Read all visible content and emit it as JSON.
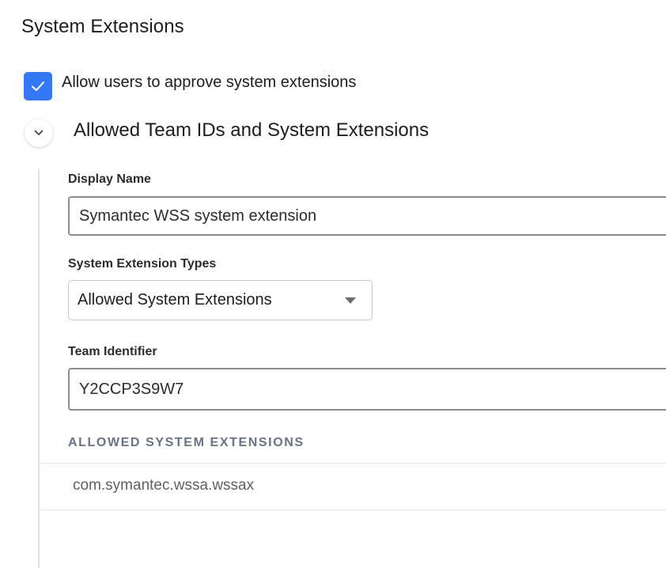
{
  "section": {
    "title": "System Extensions"
  },
  "allow_approve": {
    "label": "Allow users to approve system extensions",
    "checked": true,
    "accent_color": "#3478f6"
  },
  "group": {
    "title": "Allowed Team IDs and System Extensions",
    "expanded": true,
    "toggle_icon": "chevron-down-icon"
  },
  "fields": {
    "display_name": {
      "label": "Display Name",
      "value": "Symantec WSS system extension"
    },
    "extension_types": {
      "label": "System Extension Types",
      "selected": "Allowed System Extensions"
    },
    "team_identifier": {
      "label": "Team Identifier",
      "value": "Y2CCP3S9W7"
    }
  },
  "allowed_extensions": {
    "header": "ALLOWED SYSTEM EXTENSIONS",
    "items": [
      "com.symantec.wssa.wssax"
    ]
  }
}
